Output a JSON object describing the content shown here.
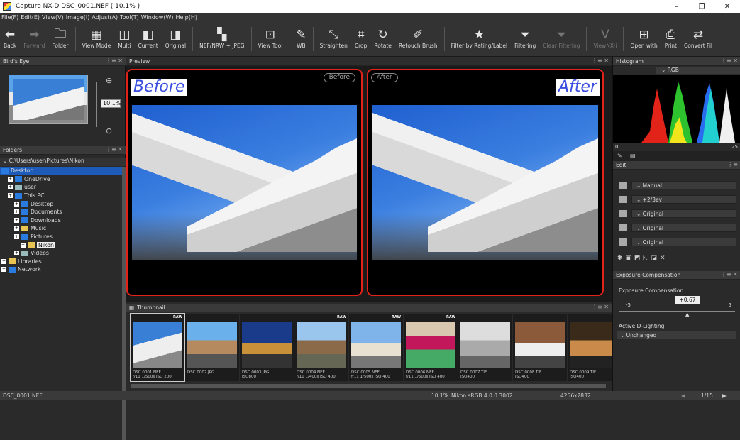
{
  "window": {
    "title": "Capture NX-D    DSC_0001.NEF ( 10.1% )",
    "minimize": "–",
    "restore": "❐",
    "close": "✕"
  },
  "menu": [
    "File(F)",
    "Edit(E)",
    "View(V)",
    "Image(I)",
    "Adjust(A)",
    "Tool(T)",
    "Window(W)",
    "Help(H)"
  ],
  "toolbar": [
    {
      "label": "Back",
      "icon": "arrow-left-icon",
      "glyph": "⬅",
      "enabled": true
    },
    {
      "label": "Forward",
      "icon": "arrow-right-icon",
      "glyph": "➡",
      "enabled": false
    },
    {
      "label": "Folder",
      "icon": "folder-icon",
      "glyph": "🗀",
      "enabled": true
    },
    {
      "label": "View Mode",
      "icon": "view-mode-icon",
      "glyph": "▦",
      "enabled": true
    },
    {
      "label": "Multi",
      "icon": "multi-view-icon",
      "glyph": "◫",
      "enabled": true
    },
    {
      "label": "Current",
      "icon": "current-view-icon",
      "glyph": "◧",
      "enabled": true
    },
    {
      "label": "Original",
      "icon": "original-view-icon",
      "glyph": "◨",
      "enabled": true
    },
    {
      "label": "NEF/NRW + JPEG",
      "icon": "nef-jpeg-icon",
      "glyph": "▚",
      "enabled": true
    },
    {
      "label": "View Tool",
      "icon": "view-tool-icon",
      "glyph": "⊡",
      "enabled": true
    },
    {
      "label": "WB",
      "icon": "white-balance-icon",
      "glyph": "✎",
      "enabled": true
    },
    {
      "label": "Straighten",
      "icon": "straighten-icon",
      "glyph": "⤡",
      "enabled": true
    },
    {
      "label": "Crop",
      "icon": "crop-icon",
      "glyph": "⌗",
      "enabled": true
    },
    {
      "label": "Rotate",
      "icon": "rotate-icon",
      "glyph": "↻",
      "enabled": true
    },
    {
      "label": "Retouch Brush",
      "icon": "retouch-brush-icon",
      "glyph": "✐",
      "enabled": true
    },
    {
      "label": "Filter by Rating/Label",
      "icon": "star-icon",
      "glyph": "★",
      "enabled": true
    },
    {
      "label": "Filtering",
      "icon": "filter-icon",
      "glyph": "⏷",
      "enabled": true
    },
    {
      "label": "Clear Filtering",
      "icon": "clear-filter-icon",
      "glyph": "⏷",
      "enabled": false
    },
    {
      "label": "ViewNX-i",
      "icon": "viewnx-icon",
      "glyph": "V",
      "enabled": false
    },
    {
      "label": "Open with",
      "icon": "open-with-icon",
      "glyph": "⊞",
      "enabled": true
    },
    {
      "label": "Print",
      "icon": "print-icon",
      "glyph": "⎙",
      "enabled": true
    },
    {
      "label": "Convert Fil",
      "icon": "convert-file-icon",
      "glyph": "⇄",
      "enabled": true
    }
  ],
  "birds_eye": {
    "title": "Bird's Eye",
    "zoom": "10.1%"
  },
  "folders": {
    "title": "Folders",
    "path": "C:\\Users\\user\\Pictures\\Nikon",
    "tree": [
      {
        "label": "Desktop",
        "indent": 0,
        "selected": true,
        "icon": "b"
      },
      {
        "label": "OneDrive",
        "indent": 1,
        "icon": "b"
      },
      {
        "label": "user",
        "indent": 1,
        "icon": "g"
      },
      {
        "label": "This PC",
        "indent": 1,
        "icon": "b"
      },
      {
        "label": "Desktop",
        "indent": 2,
        "icon": "b"
      },
      {
        "label": "Documents",
        "indent": 2,
        "icon": "b"
      },
      {
        "label": "Downloads",
        "indent": 2,
        "icon": "b"
      },
      {
        "label": "Music",
        "indent": 2,
        "icon": "y"
      },
      {
        "label": "Pictures",
        "indent": 2,
        "icon": "b"
      },
      {
        "label": "Nikon",
        "indent": 3,
        "icon": "y",
        "highlight": true
      },
      {
        "label": "Videos",
        "indent": 2,
        "icon": "g"
      },
      {
        "label": "Libraries",
        "indent": 0,
        "icon": "y"
      },
      {
        "label": "Network",
        "indent": 0,
        "icon": "b"
      }
    ]
  },
  "preview": {
    "title": "Preview",
    "before_label": "Before",
    "after_label": "After",
    "before_pill": "Before",
    "after_pill": "After",
    "accent": "#e2231a"
  },
  "histogram": {
    "title": "Histogram",
    "channel": "RGB",
    "min": "0",
    "max": "25"
  },
  "edit": {
    "title": "Edit",
    "rows": [
      {
        "icon": "picture-control-icon",
        "value": "Manual"
      },
      {
        "icon": "exposure-icon",
        "value": "+2/3ev"
      },
      {
        "icon": "white-balance-icon",
        "value": "Original"
      },
      {
        "icon": "picture-style-icon",
        "value": "Original"
      },
      {
        "icon": "tone-icon",
        "value": "Original"
      }
    ]
  },
  "exposure": {
    "title": "Exposure Compensation",
    "label": "Exposure Compensation",
    "min": "-5",
    "max": "5",
    "value": "+0.67"
  },
  "adl": {
    "title": "Active D-Lighting",
    "value": "Unchanged"
  },
  "thumbnail": {
    "title": "Thumbnail",
    "items": [
      {
        "name": "DSC 0001.NEF",
        "meta": "f/11 1/500s ISO 200",
        "raw": true,
        "selected": true
      },
      {
        "name": "DSC 0002.JPG",
        "meta": "",
        "raw": false
      },
      {
        "name": "DSC 0003.JPG",
        "meta": "ISO800",
        "raw": false
      },
      {
        "name": "DSC 0004.NEF",
        "meta": "f/10 1/400s ISO 400",
        "raw": true
      },
      {
        "name": "DSC 0005.NEF",
        "meta": "f/11 1/500s ISO 400",
        "raw": true
      },
      {
        "name": "DSC 0006.NEF",
        "meta": "f/11 1/500s ISO 400",
        "raw": true
      },
      {
        "name": "DSC 0007.TIF",
        "meta": "ISO400",
        "raw": false
      },
      {
        "name": "DSC 0008.TIF",
        "meta": "ISO400",
        "raw": false
      },
      {
        "name": "DSC 0009.TIF",
        "meta": "ISO400",
        "raw": false
      }
    ]
  },
  "status": {
    "filename": "DSC_0001.NEF",
    "zoom": "10.1%",
    "profile": "Nikon sRGB 4.0.0.3002",
    "size": "4256x2832",
    "page": "1/15"
  }
}
